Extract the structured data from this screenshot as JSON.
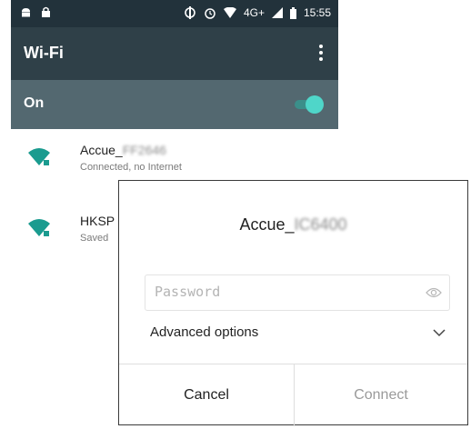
{
  "status_bar": {
    "time": "15:55",
    "network": "4G+",
    "icons": [
      "android-robot-icon",
      "lock-icon",
      "data-sync-icon",
      "alarm-icon",
      "wifi-signal-icon",
      "cell-signal-icon",
      "battery-icon"
    ]
  },
  "app_bar": {
    "title": "Wi-Fi",
    "overflow_icon": "overflow-menu-icon"
  },
  "wifi_toggle": {
    "label": "On",
    "state": true,
    "accent_color": "#4fd6c9"
  },
  "networks": [
    {
      "name_visible": "Accue_",
      "name_obscured": "FF2646",
      "status": "Connected, no Internet"
    },
    {
      "name_visible": "HKSP",
      "status": "Saved"
    }
  ],
  "dialog": {
    "title_visible": "Accue_",
    "title_obscured": "IC6400",
    "password_placeholder": "Password",
    "advanced_options_label": "Advanced options",
    "cancel_label": "Cancel",
    "connect_label": "Connect"
  }
}
